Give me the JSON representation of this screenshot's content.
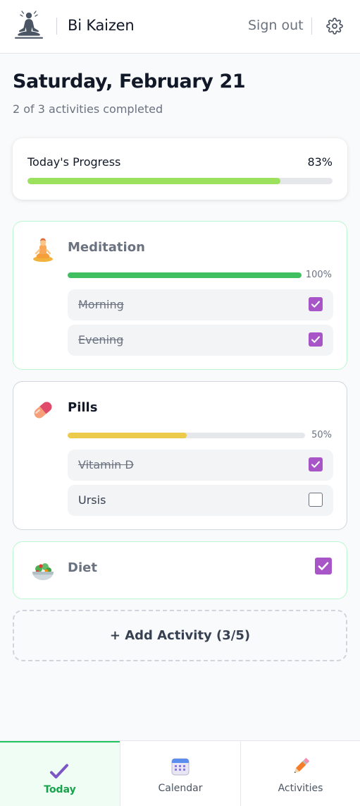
{
  "header": {
    "app_title": "Bi Kaizen",
    "sign_out_label": "Sign out",
    "logo_icon": "meditation-logo-icon",
    "settings_icon": "gear-icon"
  },
  "page": {
    "title": "Saturday, February 21",
    "subtitle": "2 of 3 activities completed"
  },
  "progress": {
    "label": "Today's Progress",
    "value": "83%",
    "percent": 83,
    "color": "#9be15d"
  },
  "activities": [
    {
      "name": "Meditation",
      "icon": "meditation-icon",
      "percent_label": "100%",
      "percent": 100,
      "color": "#3fbf5f",
      "items": [
        {
          "label": "Morning",
          "checked": true
        },
        {
          "label": "Evening",
          "checked": true
        }
      ]
    },
    {
      "name": "Pills",
      "icon": "pill-icon",
      "percent_label": "50%",
      "percent": 50,
      "color": "#eccb4a",
      "items": [
        {
          "label": "Vitamin D",
          "checked": true
        },
        {
          "label": "Ursis",
          "checked": false
        }
      ]
    },
    {
      "name": "Diet",
      "icon": "salad-icon",
      "checked": true
    }
  ],
  "add_button_label": "+ Add Activity (3/5)",
  "tabs": [
    {
      "label": "Today",
      "icon": "checkmark-icon",
      "active": true
    },
    {
      "label": "Calendar",
      "icon": "calendar-icon",
      "active": false
    },
    {
      "label": "Activities",
      "icon": "pencil-icon",
      "active": false
    }
  ],
  "colors": {
    "accent_check": "#a855c7",
    "active_tab": "#16a34a"
  }
}
